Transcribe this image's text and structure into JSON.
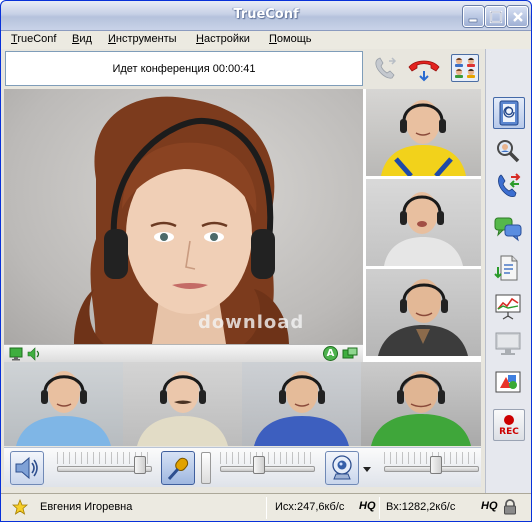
{
  "window": {
    "title": "TrueConf"
  },
  "menu": {
    "items": [
      {
        "label": "TrueConf"
      },
      {
        "label": "Вид"
      },
      {
        "label": "Инструменты"
      },
      {
        "label": "Настройки"
      },
      {
        "label": "Помощь"
      }
    ]
  },
  "conference": {
    "status": "Идет конференция 00:00:41"
  },
  "icons": {
    "call": "phone-call-icon",
    "hangup": "hangup-icon",
    "layout": "participants-layout-icon",
    "signal": "signal-strength-icon",
    "address_book": "address-book-icon",
    "search_user": "search-user-icon",
    "transfer": "call-transfer-icon",
    "chat": "chat-icon",
    "files": "file-transfer-icon",
    "slideshow": "slideshow-icon",
    "screen": "screen-share-icon",
    "whiteboard": "whiteboard-icon",
    "record": "record-icon",
    "speaker": "speaker-icon",
    "microphone": "microphone-icon",
    "camera": "webcam-icon",
    "star": "star-icon",
    "lock": "lock-icon"
  },
  "record_button": {
    "label": "REC"
  },
  "sliders": {
    "speaker_volume": 0.93,
    "mic_volume": 0.4,
    "camera_level": 0.55
  },
  "main_video": {
    "watermark": "download",
    "avatar_badge": "A"
  },
  "statusbar": {
    "user_name": "Евгения Игоревна",
    "outgoing": "Исх:247,6кб/с",
    "outgoing_quality": "HQ",
    "incoming": "Вх:1282,2кб/с",
    "incoming_quality": "HQ"
  },
  "colors": {
    "accent": "#0831d9",
    "rec": "#cc0000",
    "signal": "#2fa12f"
  }
}
